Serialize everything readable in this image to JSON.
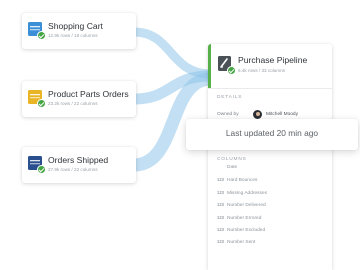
{
  "sources": [
    {
      "title": "Shopping Cart",
      "meta": "12.9k rows / 18 columns",
      "icon": "table-dataset-icon",
      "status": "check-icon"
    },
    {
      "title": "Product Parts Orders",
      "meta": "23.2k rows / 22 columns",
      "icon": "table-dataset-icon",
      "status": "check-icon"
    },
    {
      "title": "Orders Shipped",
      "meta": "27.9k rows / 22 columns",
      "icon": "table-dataset-icon",
      "status": "check-icon"
    }
  ],
  "pipeline": {
    "title": "Purchase Pipeline",
    "meta": "6.4k rows / 33 columns",
    "icon": "pipeline-icon",
    "status": "check-icon",
    "details_label": "DETAILS",
    "owned_by_label": "Owned by",
    "owner_name": "Mitchell Moody",
    "columns_label": "COLUMNS",
    "columns": [
      {
        "type": "",
        "name": "Date"
      },
      {
        "type": "123",
        "name": "Hard Bounces"
      },
      {
        "type": "123",
        "name": "Missing Addresses"
      },
      {
        "type": "123",
        "name": "Number Delivered"
      },
      {
        "type": "123",
        "name": "Number Errored"
      },
      {
        "type": "123",
        "name": "Number Excluded"
      },
      {
        "type": "123",
        "name": "Number Sent"
      }
    ]
  },
  "tooltip": {
    "text": "Last updated 20 min ago"
  },
  "colors": {
    "flow": "#8fc4ea",
    "status_green": "#46a645",
    "accent_green": "#58b04a",
    "icon_blue": "#3b8fd6",
    "icon_gold": "#e9b526",
    "icon_navy": "#2a4f8f"
  }
}
